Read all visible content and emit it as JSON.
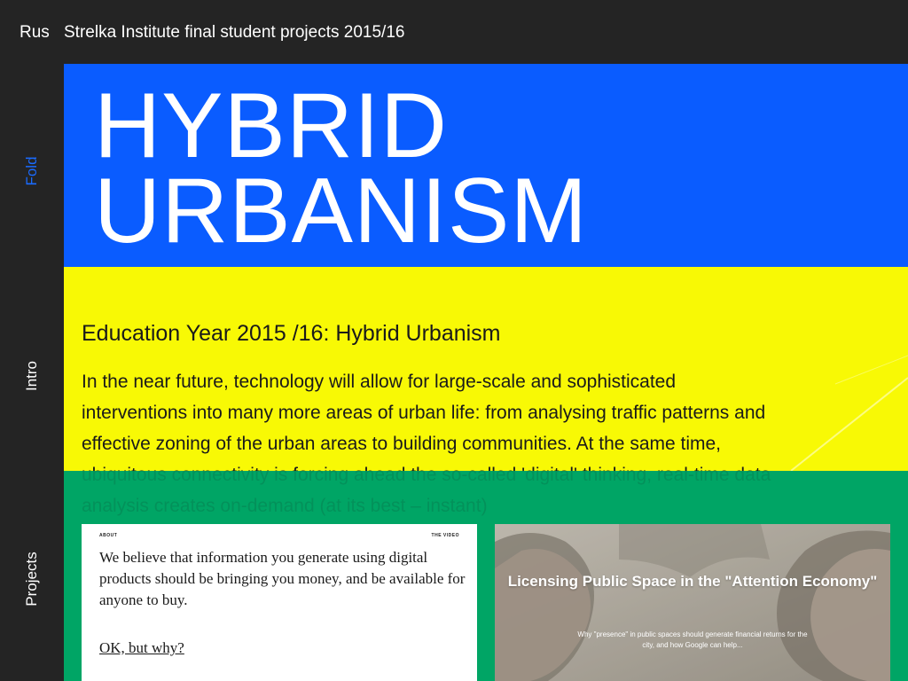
{
  "topbar": {
    "lang": "Rus",
    "site_title": "Strelka Institute final student projects 2015/16"
  },
  "sidenav": {
    "items": [
      {
        "label": "Fold",
        "active": true
      },
      {
        "label": "Intro",
        "active": false
      },
      {
        "label": "Projects",
        "active": false
      }
    ]
  },
  "hero": {
    "line1": "HYBRID",
    "line2": "URBANISM"
  },
  "intro": {
    "heading": "Education Year 2015 /16: Hybrid Urbanism",
    "paragraph": "In the near future, technology will allow for large-scale and sophisticated interventions into many more areas of urban life: from analysing traffic patterns and effective zoning of the urban areas to building communities. At the same time, ubiquitous connectivity is forcing ahead the so-called 'digital' thinking, real-time data analysis creates on-demand (at its best – instant)"
  },
  "cards": {
    "left": {
      "about": "ABOUT",
      "video": "THE VIDEO",
      "quote": "We believe that information you generate using digital products should be bringing you money, and be available for anyone to buy.",
      "cta": "OK, but why?"
    },
    "right": {
      "title": "Licensing Public Space in the \"Attention Economy\"",
      "subtitle": "Why \"presence\" in public spaces should generate financial returns for the city, and how Google can help..."
    }
  },
  "colors": {
    "blue": "#0a5cff",
    "yellow": "#f8f905",
    "green": "#00a565",
    "dark": "#242424",
    "active_nav": "#1a6bff"
  }
}
